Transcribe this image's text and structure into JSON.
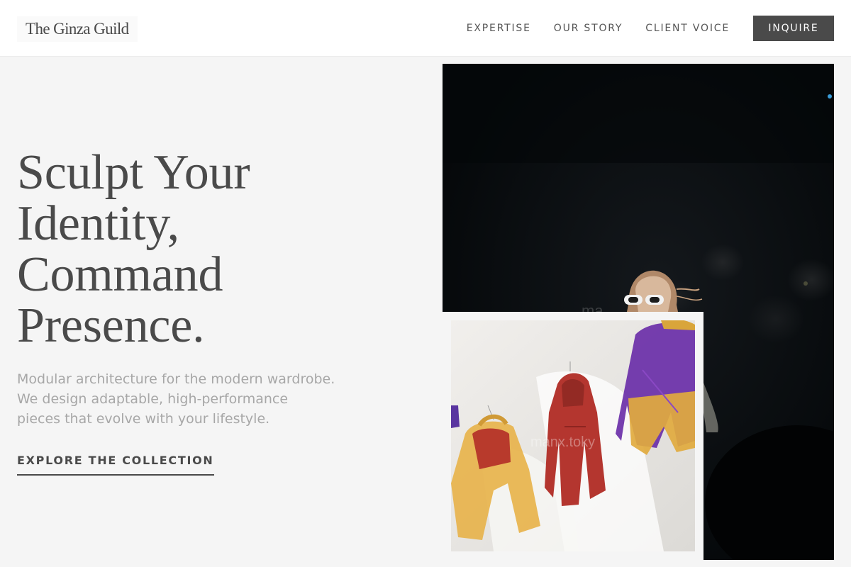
{
  "brand": {
    "name": "The Ginza Guild"
  },
  "nav": {
    "links": [
      "EXPERTISE",
      "OUR STORY",
      "CLIENT VOICE"
    ],
    "cta_label": "INQUIRE"
  },
  "hero": {
    "headline_lines": [
      "Sculpt Your",
      "Identity,",
      "Command",
      "Presence."
    ],
    "subtitle_lines": [
      "Modular architecture for the modern wardrobe.",
      "We design adaptable, high-performance",
      "pieces that evolve with your lifestyle."
    ],
    "cta_label": "EXPLORE THE COLLECTION"
  },
  "images": {
    "runway_watermark": "ma",
    "jackets_watermark": "manx.toky"
  },
  "colors": {
    "text": "#4a4a4a",
    "muted_text": "#a7a7a7",
    "page_background": "#f5f5f5",
    "button_background": "#4a4a4a",
    "button_text": "#ffffff"
  }
}
